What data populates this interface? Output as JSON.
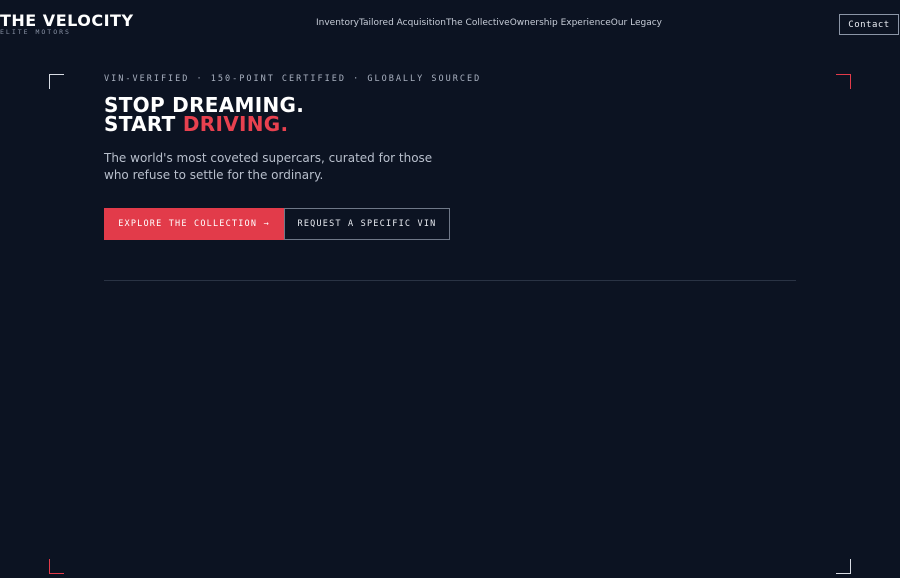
{
  "brand": {
    "name": "THE VELOCITY",
    "tagline": "ELITE MOTORS"
  },
  "nav": {
    "links": [
      "Inventory",
      "Tailored Acquisition",
      "The Collective",
      "Ownership Experience",
      "Our Legacy"
    ],
    "contact_label": "Contact"
  },
  "hero": {
    "eyebrow": "VIN-VERIFIED · 150-POINT CERTIFIED · GLOBALLY SOURCED",
    "headline_line1": "STOP DREAMING.",
    "headline_line2_prefix": "START ",
    "headline_line2_accent": "DRIVING.",
    "subtitle": "The world's most coveted supercars, curated for those who refuse to settle for the ordinary.",
    "primary_cta": "EXPLORE THE COLLECTION →",
    "secondary_cta": "REQUEST A SPECIFIC VIN"
  },
  "colors": {
    "background": "#0c1322",
    "accent": "#e23b4a",
    "text": "#ffffff"
  }
}
